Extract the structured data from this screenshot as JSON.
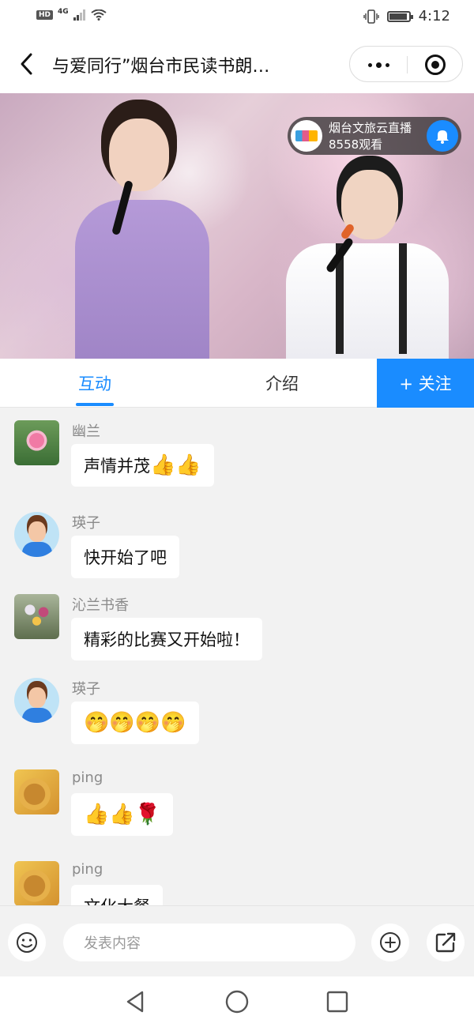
{
  "status_bar": {
    "hd": "HD",
    "network": "4G",
    "time": "4:12",
    "battery_level": 0.9
  },
  "nav": {
    "title": "与爱同行”烟台市民读书朗…"
  },
  "video": {
    "channel_name": "烟台文旅云直播",
    "viewer_count": "8558观看"
  },
  "tabs": {
    "items": [
      {
        "label": "互动",
        "active": true
      },
      {
        "label": "介绍",
        "active": false
      }
    ],
    "follow_label": "+ 关注"
  },
  "comments": [
    {
      "user": "幽兰",
      "avatar": "lotus-avatar",
      "text": "声情并茂",
      "emoji": "👍👍"
    },
    {
      "user": "瑛子",
      "avatar": "boy-avatar",
      "text": "快开始了吧",
      "emoji": ""
    },
    {
      "user": "沁兰书香",
      "avatar": "orchid-avatar",
      "text": "精彩的比赛又开始啦！",
      "emoji": ""
    },
    {
      "user": "瑛子",
      "avatar": "boy-avatar",
      "text": "",
      "emoji": "🤭🤭🤭🤭"
    },
    {
      "user": "ping",
      "avatar": "sunflower-avatar",
      "text": "",
      "emoji": "👍👍🌹"
    },
    {
      "user": "ping",
      "avatar": "sunflower-avatar",
      "text": "文化大餐",
      "emoji": ""
    }
  ],
  "input": {
    "placeholder": "发表内容"
  },
  "colors": {
    "accent": "#1a8cff",
    "background": "#f2f2f2",
    "username": "#8a8a8a"
  }
}
